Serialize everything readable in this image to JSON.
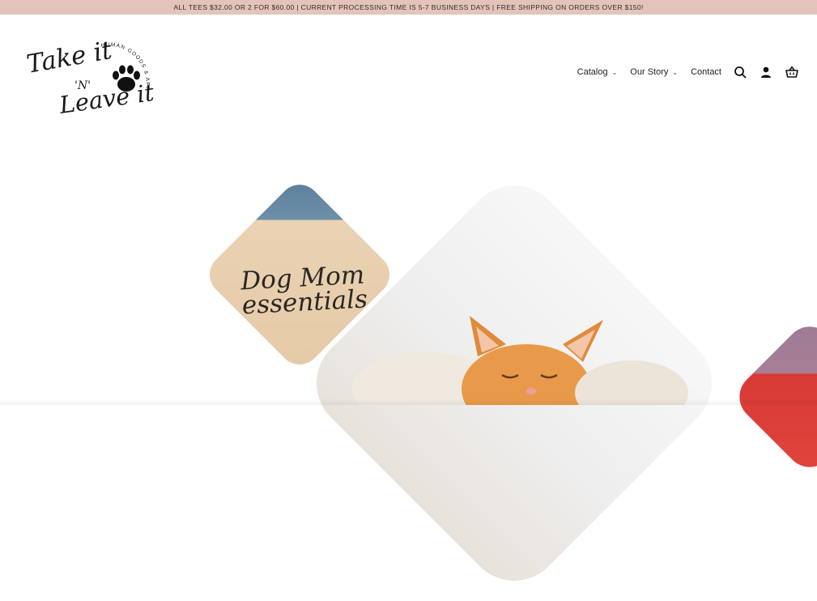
{
  "announcement": "ALL TEES $32.00 OR 2 FOR $60.00 | CURRENT PROCESSING TIME IS 5-7 BUSINESS DAYS | FREE SHIPPING ON ORDERS OVER $150!",
  "logo": {
    "line1": "Take it",
    "line2": "'N'",
    "line3": "Leave it",
    "arc_text": "HUMAN GOODS & APPAREL",
    "icon": "paw-print-icon"
  },
  "nav": {
    "items": [
      {
        "label": "Catalog",
        "has_dropdown": true
      },
      {
        "label": "Our Story",
        "has_dropdown": true
      },
      {
        "label": "Contact",
        "has_dropdown": false
      }
    ],
    "icons": [
      "search-icon",
      "account-icon",
      "cart-icon"
    ]
  },
  "hero": {
    "tote_text_line1": "Dog Mom",
    "tote_text_line2": "essentials"
  },
  "colors": {
    "announcement_bg": "#e3c4ba",
    "tote": "#ead2b3",
    "kitten_fur": "#e89a4a"
  }
}
